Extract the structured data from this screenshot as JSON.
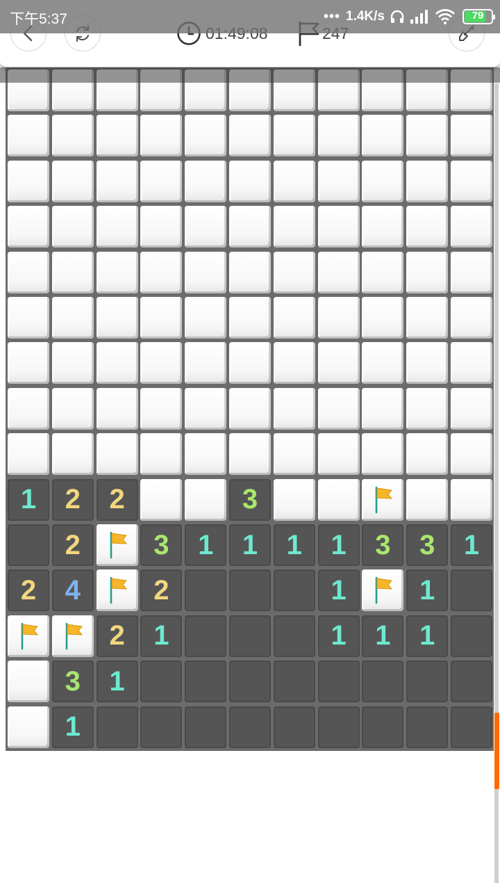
{
  "status_bar": {
    "time": "下午5:37",
    "network_speed": "1.4K/s",
    "battery_level": "79",
    "battery_fraction": 0.79
  },
  "header": {
    "timer": "01:49:08",
    "flags_remaining": "247",
    "icons": [
      "back-icon",
      "refresh-icon",
      "clock-icon",
      "flag-icon",
      "shovel-icon"
    ]
  },
  "board": {
    "columns": 11,
    "rows": 15,
    "legend": "H = hidden, F = flagged, E = revealed empty, digit = revealed number",
    "grid": [
      "HHHHHHHHHHH",
      "HHHHHHHHHHH",
      "HHHHHHHHHHH",
      "HHHHHHHHHHH",
      "HHHHHHHHHHH",
      "HHHHHHHHHHH",
      "HHHHHHHHHHH",
      "HHHHHHHHHHH",
      "HHHHHHHHHHH",
      "122HH3HHFHH",
      "E2F31111331",
      "24F2EEE1F1E",
      "FF21EEE111E",
      "H31EEEEEEEE",
      "H1EEEEEEEEE"
    ],
    "number_colors": {
      "1": "#6ee8d0",
      "2": "#f2d77f",
      "3": "#a9e66e",
      "4": "#7fb2ee"
    },
    "flag_color": "#f5b62a"
  },
  "scroll": {
    "position_fraction": 0.87
  }
}
